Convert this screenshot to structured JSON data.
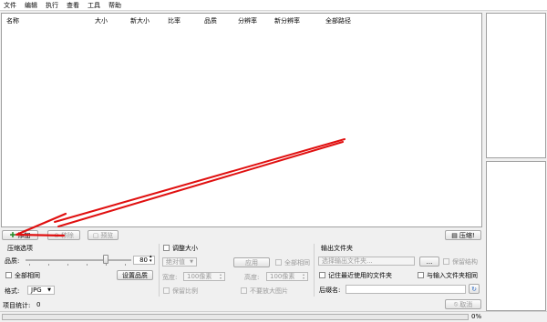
{
  "menu": [
    "文件",
    "编辑",
    "执行",
    "查看",
    "工具",
    "帮助"
  ],
  "columns": [
    "名称",
    "大小",
    "新大小",
    "比率",
    "品质",
    "分辨率",
    "新分辨率",
    "全部路径"
  ],
  "toolbar": {
    "add_label": "添加",
    "remove_label": "移除",
    "preview_label": "预览",
    "compress_label": "压缩!"
  },
  "compress_options": {
    "title": "压缩选项",
    "quality_label": "品质:",
    "quality_value": "80",
    "quality_fraction": 0.8,
    "all_same_label": "全部相同",
    "set_quality_button": "设置品质",
    "format_label": "格式:",
    "format_value": "JPG"
  },
  "resize": {
    "title": "调整大小",
    "mode_value": "绝对值",
    "apply_button": "应用",
    "all_same_label": "全部相同",
    "width_label": "宽度:",
    "width_value": "100像素",
    "height_label": "高度:",
    "height_value": "100像素",
    "keep_ratio_label": "保留比例",
    "no_enlarge_label": "不要放大图片"
  },
  "output": {
    "title": "输出文件夹",
    "folder_placeholder": "选择输出文件夹...",
    "browse_button": "...",
    "keep_structure_label": "保留结构",
    "remember_recent_label": "记住最近使用的文件夹",
    "same_as_input_label": "与输入文件夹相同",
    "suffix_label": "后缀名:"
  },
  "status": {
    "item_count_label": "项目统计:",
    "item_count_value": "0",
    "cancel_button": "取消",
    "progress_percent": "0%",
    "progress_value": 0
  },
  "colors": {
    "arrow": "#e01010",
    "panel_bg": "#f0f0f0",
    "list_bg": "#ffffff"
  }
}
